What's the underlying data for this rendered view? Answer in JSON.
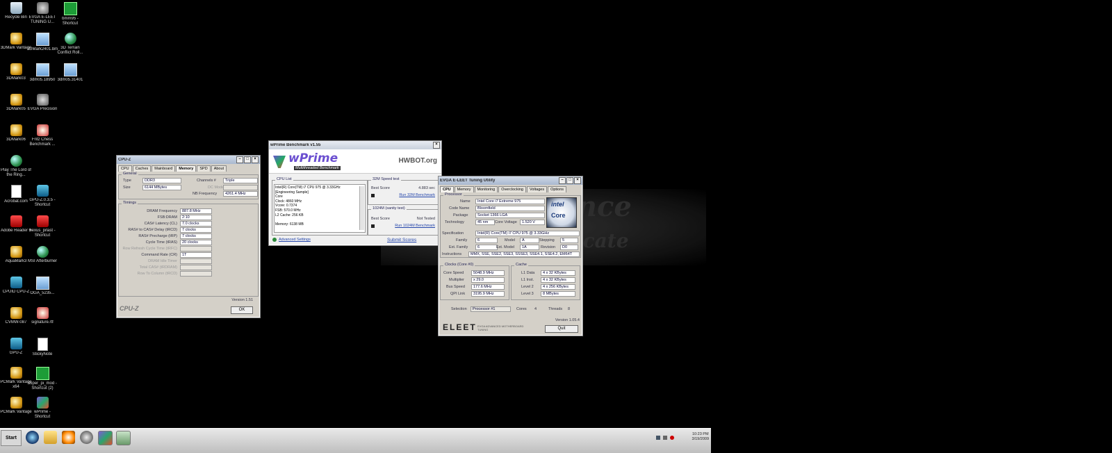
{
  "desktop_icons": [
    {
      "label": "Recycle Bin",
      "type": "bin"
    },
    {
      "label": "EVGA E-LEET TUNING U...",
      "type": "gear"
    },
    {
      "label": "bmm95 - Shortcut",
      "type": "green"
    },
    {
      "label": "3DMark Vantage",
      "type": "shortcut"
    },
    {
      "label": "3DMark2401.bm",
      "type": "img"
    },
    {
      "label": "3D Terrain Conflict Roll...",
      "type": "globe"
    },
    {
      "label": "3DMark03",
      "type": "shortcut"
    },
    {
      "label": "3dm05.18950",
      "type": "img"
    },
    {
      "label": "3dm05.31401",
      "type": "img"
    },
    {
      "label": "3DMark05",
      "type": "shortcut"
    },
    {
      "label": "EVGA Precision",
      "type": "gear"
    },
    {
      "label": "3DMark06",
      "type": "shortcut"
    },
    {
      "label": "Fritz Chess Benchmark ...",
      "type": "music"
    },
    {
      "label": "Play The Lord of the Ring...",
      "type": "globe"
    },
    {
      "label": "Acrobat.com",
      "type": "doc"
    },
    {
      "label": "GPU-Z.0.3.5 - Shortcut",
      "type": "chip"
    },
    {
      "label": "Adobe Reader 9",
      "type": "red"
    },
    {
      "label": "hexus_pifast - Shortcut",
      "type": "red"
    },
    {
      "label": "AquaMark3",
      "type": "shortcut"
    },
    {
      "label": "MSI Afterburner",
      "type": "globe"
    },
    {
      "label": "CPUID CPU-Z",
      "type": "chip"
    },
    {
      "label": "OGA_5235...",
      "type": "img"
    },
    {
      "label": "CVMW-087",
      "type": "shortcut"
    },
    {
      "label": "signature.rtf",
      "type": "music"
    },
    {
      "label": "GPU-Z",
      "type": "chip"
    },
    {
      "label": "StickyNote",
      "type": "doc"
    },
    {
      "label": "PCMark Vantage x64",
      "type": "shortcut"
    },
    {
      "label": "super_pi_mod - Shortcut (2)",
      "type": "green"
    },
    {
      "label": "PCMark Vantage",
      "type": "shortcut"
    },
    {
      "label": "wPrime - Shortcut",
      "type": "wprime"
    }
  ],
  "bg_logo": {
    "word1": "ance",
    "word2": "ndicate"
  },
  "cpuz": {
    "title": "CPU-Z",
    "tabs": [
      "CPU",
      "Caches",
      "Mainboard",
      "Memory",
      "SPD",
      "About"
    ],
    "active_tab": "Memory",
    "general_legend": "General",
    "type_label": "Type",
    "type_value": "DDR3",
    "size_label": "Size",
    "size_value": "6144 MBytes",
    "channels_label": "Channels #",
    "channels_value": "Triple",
    "dc_mode_label": "DC Mode",
    "dc_mode_value": "",
    "nb_freq_label": "NB Frequency",
    "nb_freq_value": "4261.4 MHz",
    "timings_legend": "Timings",
    "timings": [
      {
        "label": "DRAM Frequency",
        "value": "887.8 MHz",
        "dim": false
      },
      {
        "label": "FSB:DRAM",
        "value": "2:10",
        "dim": false
      },
      {
        "label": "CAS# Latency (CL)",
        "value": "7.0 clocks",
        "dim": false
      },
      {
        "label": "RAS# to CAS# Delay (tRCD)",
        "value": "7 clocks",
        "dim": false
      },
      {
        "label": "RAS# Precharge (tRP)",
        "value": "7 clocks",
        "dim": false
      },
      {
        "label": "Cycle Time (tRAS)",
        "value": "20 clocks",
        "dim": false
      },
      {
        "label": "Row Refresh Cycle Time (tRFC)",
        "value": "",
        "dim": true
      },
      {
        "label": "Command Rate (CR)",
        "value": "1T",
        "dim": false
      },
      {
        "label": "DRAM Idle Timer",
        "value": "",
        "dim": true
      },
      {
        "label": "Total CAS# (tRDRAM)",
        "value": "",
        "dim": true
      },
      {
        "label": "Row To Column (tRCD)",
        "value": "",
        "dim": true
      }
    ],
    "version": "Version 1.51",
    "brand": "CPU-Z",
    "ok_label": "OK"
  },
  "wprime": {
    "title": "wPrime Benchmark v1.55",
    "logo": "wPrime",
    "logo_sub": "Multithreaded Benchmark",
    "hwbot": "HWBOT.org",
    "cpu_list_legend": "CPU List",
    "cpu_lines": [
      "Intel(R) Core(TM) i7 CPU      975 @ 3.33GHz",
      "[Engineering Sample]",
      "Core",
      "Clock: 4860 MHz",
      "Vcore: 0.7374",
      "FSB: 570.0 MHz",
      "L2 Cache: 256 KB",
      "",
      "Memory: 6138 MB"
    ],
    "s32_legend": "32M Speed test",
    "s32_score_label": "Best Score",
    "s32_score_value": "4.883 sec",
    "s32_run": "Run 32M Benchmark",
    "s1024_legend": "1024M (sanity test)",
    "s1024_score_label": "Best Score",
    "s1024_score_value": "Not Tested",
    "s1024_run": "Run 1024M Benchmark",
    "advanced": "Advanced Settings",
    "submit": "Submit Scores"
  },
  "eleet": {
    "title": "EVGA E-LEET Tuning Utility",
    "tabs": [
      "CPU",
      "Memory",
      "Monitoring",
      "Overclocking",
      "Voltages",
      "Options"
    ],
    "active_tab": "CPU",
    "processor_legend": "Processor",
    "name_label": "Name",
    "name_value": "Intel Core i7 Extreme 975",
    "codename_label": "Code Name",
    "codename_value": "Bloomfield",
    "package_label": "Package",
    "package_value": "Socket 1366 LGA",
    "technology_label": "Technology",
    "technology_value": "45 nm",
    "core_voltage_label": "Core Voltage",
    "core_voltage_value": "1.520 V",
    "intel_badge": "intel",
    "core_badge": "Core",
    "spec_label": "Specification",
    "spec_value": "Intel(R) Core(TM) i7 CPU      975 @ 3.33GHz",
    "family_label": "Family",
    "family_value": "6",
    "model_label": "Model",
    "model_value": "A",
    "stepping_label": "Stepping",
    "stepping_value": "5",
    "ext_family_label": "Ext. Family",
    "ext_family_value": "6",
    "ext_model_label": "Ext. Model",
    "ext_model_value": "1A",
    "revision_label": "Revision",
    "revision_value": "D0",
    "instructions_label": "Instructions",
    "instructions_value": "MMX, SSE, SSE2, SSE3, SSSE3, SSE4.1, SSE4.2, EM64T",
    "clocks_legend": "Clocks (Core #0)",
    "core_speed_label": "Core Speed",
    "core_speed_value": "5048.9 MHz",
    "multiplier_label": "Multiplier",
    "multiplier_value": "x 29.0",
    "bus_speed_label": "Bus Speed",
    "bus_speed_value": "177.6 MHz",
    "qpi_label": "QPI Link",
    "qpi_value": "3195.9 MHz",
    "cache_legend": "Cache",
    "l1d_label": "L1 Data",
    "l1d_value": "4 x 32 KBytes",
    "l1i_label": "L1 Inst.",
    "l1i_value": "4 x 32 KBytes",
    "l2_label": "Level 2",
    "l2_value": "4 x 256 KBytes",
    "l3_label": "Level 3",
    "l3_value": "8 MBytes",
    "selection_label": "Selection",
    "selection_value": "Processor #1",
    "cores_label": "Cores",
    "cores_value": "4",
    "threads_label": "Threads",
    "threads_value": "8",
    "version": "Version 1.05.4",
    "brand": "ELEET",
    "brand_sub": "EVGA ADVANCED MOTHERBOARD TUNING",
    "quit_label": "Quit"
  },
  "taskbar": {
    "start_label": "Start",
    "clock_time": "10:23 PM",
    "clock_date": "3/19/2009"
  }
}
